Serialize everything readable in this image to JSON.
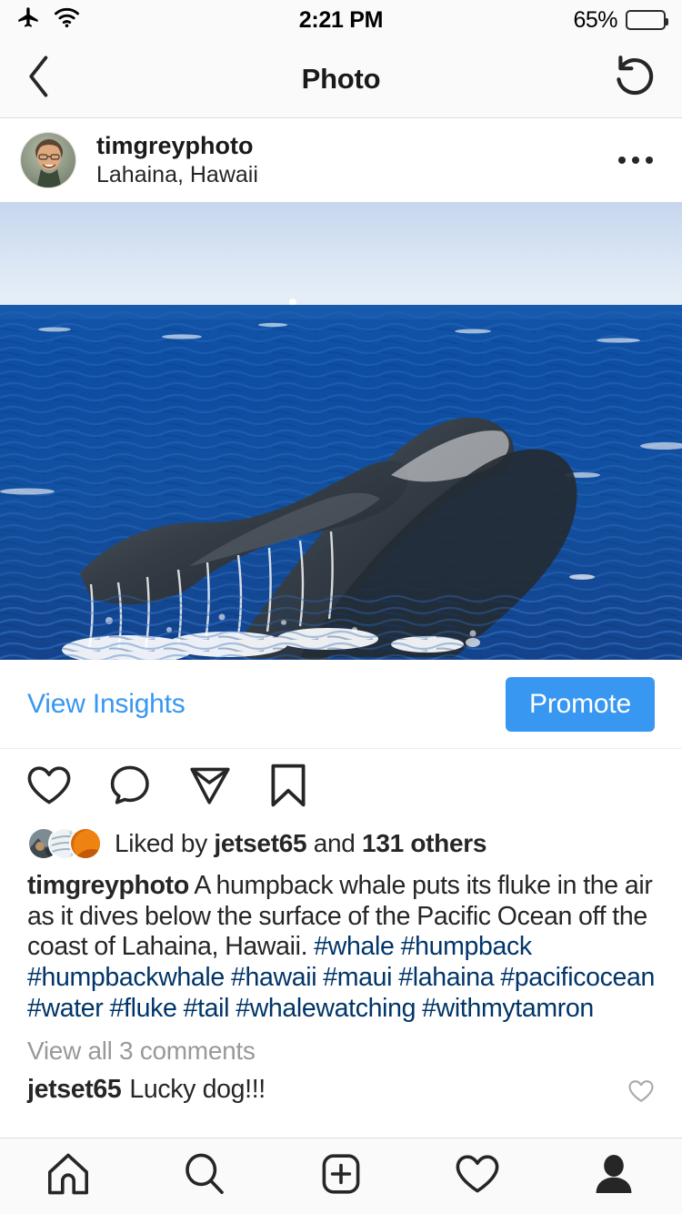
{
  "status_bar": {
    "airplane_icon": "airplane-mode-icon",
    "wifi_icon": "wifi-icon",
    "time": "2:21 PM",
    "battery_percent": "65%",
    "battery_level": 65
  },
  "nav_bar": {
    "back_icon": "back-chevron-icon",
    "title": "Photo",
    "refresh_icon": "refresh-icon"
  },
  "post_header": {
    "avatar_alt": "timgreyphoto profile photo",
    "username": "timgreyphoto",
    "location": "Lahaina, Hawaii",
    "more_icon": "more-options-icon"
  },
  "photo": {
    "alt": "Humpback whale fluke above the ocean surface",
    "sky_color": "#cfdcf0",
    "ocean_color": "#0b4ba0",
    "whale_color": "#2f3640"
  },
  "insights": {
    "view_insights_label": "View Insights",
    "promote_label": "Promote",
    "accent_color": "#3897f0"
  },
  "actions": {
    "like_icon": "heart-icon",
    "comment_icon": "comment-bubble-icon",
    "share_icon": "share-paper-plane-icon",
    "save_icon": "bookmark-icon"
  },
  "likes": {
    "prefix": "Liked by ",
    "username": "jetset65",
    "middle": " and ",
    "others": "131 others",
    "others_count": 131,
    "avatar_count": 3
  },
  "caption": {
    "username": "timgreyphoto",
    "text": "A humpback whale puts its fluke in the air as it dives below the surface of the Pacific Ocean off the coast of Lahaina, Hawaii.",
    "hashtags": [
      "#whale",
      "#humpback",
      "#humpbackwhale",
      "#hawaii",
      "#maui",
      "#lahaina",
      "#pacificocean",
      "#water",
      "#fluke",
      "#tail",
      "#whalewatching",
      "#withmytamron"
    ],
    "hashtag_color": "#003569"
  },
  "comments": {
    "view_all_label": "View all 3 comments",
    "count": 3,
    "items": [
      {
        "username": "jetset65",
        "text": "Lucky dog!!!",
        "like_icon": "heart-icon"
      }
    ]
  },
  "tab_bar": {
    "tabs": [
      {
        "name": "home",
        "icon": "home-icon"
      },
      {
        "name": "search",
        "icon": "search-icon"
      },
      {
        "name": "add-post",
        "icon": "plus-square-icon"
      },
      {
        "name": "activity",
        "icon": "heart-icon"
      },
      {
        "name": "profile",
        "icon": "person-icon"
      }
    ]
  }
}
